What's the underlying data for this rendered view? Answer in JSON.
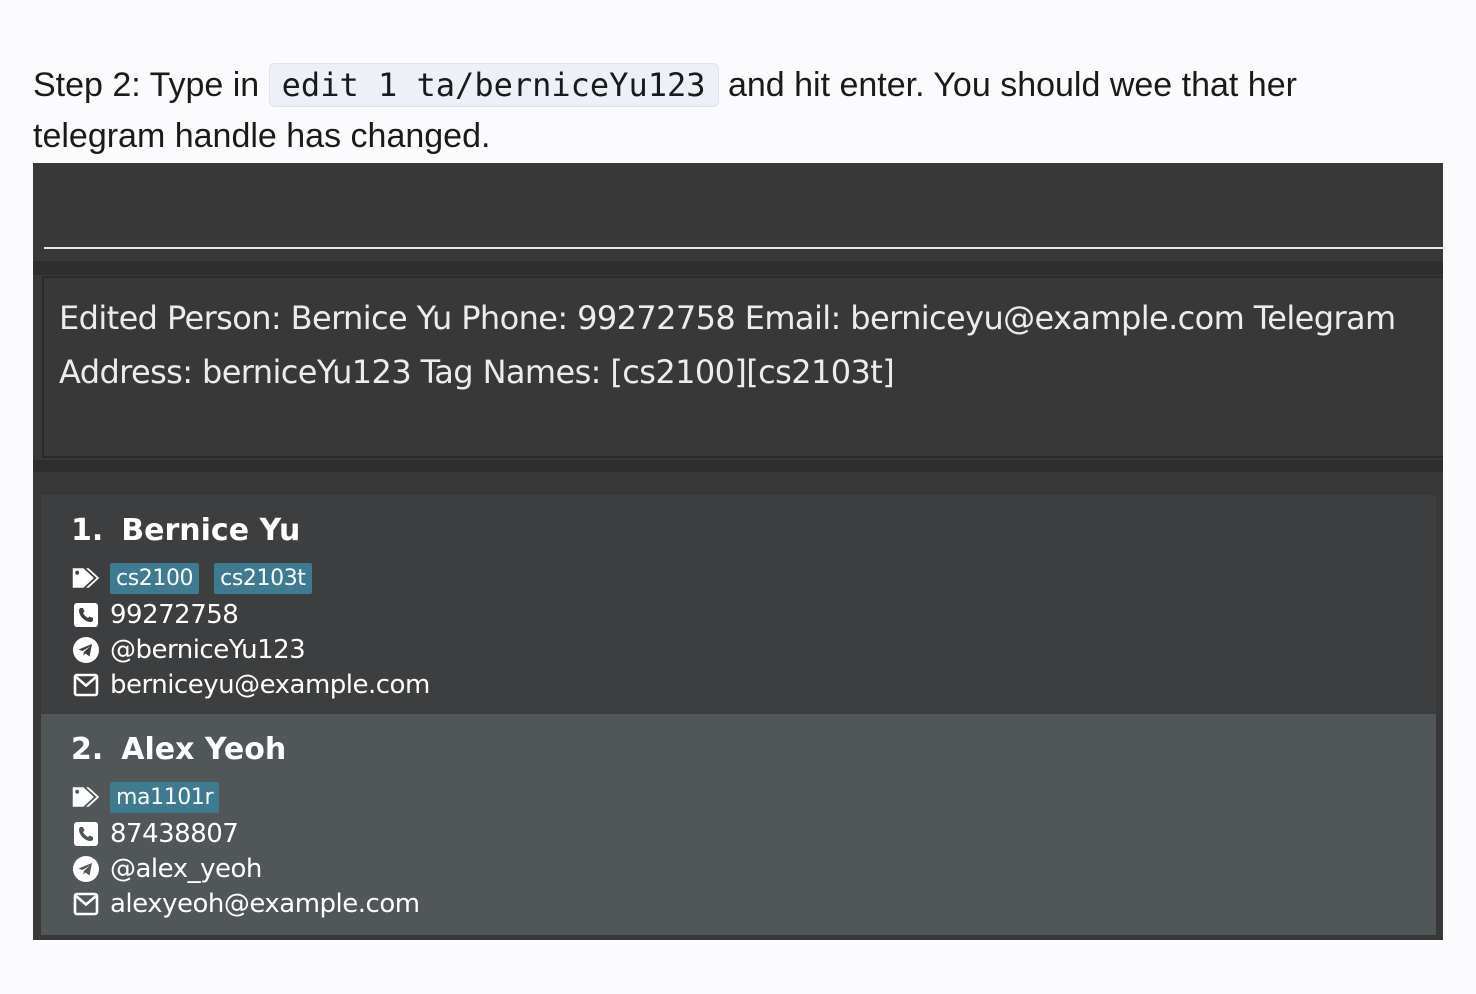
{
  "instruction": {
    "prefix": "Step 2: Type in ",
    "command": "edit 1 ta/berniceYu123",
    "suffix": " and hit enter. You should wee that her telegram handle has changed."
  },
  "app": {
    "command_box": {
      "value": ""
    },
    "result_display": {
      "text": "Edited Person: Bernice Yu Phone: 99272758 Email: berniceyu@example.com Telegram Address: berniceYu123 Tag Names: [cs2100][cs2103t]"
    },
    "persons": [
      {
        "index": "1.",
        "name": "Bernice Yu",
        "tags": [
          "cs2100",
          "cs2103t"
        ],
        "phone": "99272758",
        "telegram": "@berniceYu123",
        "email": "berniceyu@example.com"
      },
      {
        "index": "2.",
        "name": "Alex Yeoh",
        "tags": [
          "ma1101r"
        ],
        "phone": "87438807",
        "telegram": "@alex_yeoh",
        "email": "alexyeoh@example.com"
      }
    ]
  },
  "colors": {
    "panel_bg": "#383838",
    "card_bg": "#3c3e3f",
    "card_selected_bg": "#515658",
    "tag_bg": "#3e7b91",
    "text": "#ffffff"
  },
  "icons": {
    "tags": "tags-icon",
    "phone": "phone-icon",
    "telegram": "telegram-icon",
    "email": "envelope-icon"
  }
}
